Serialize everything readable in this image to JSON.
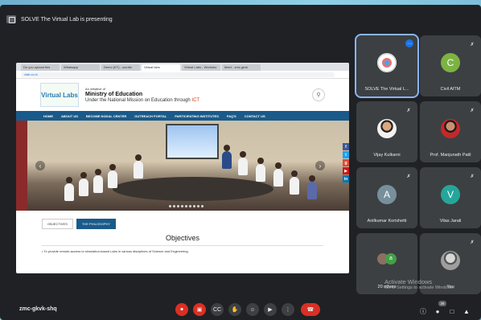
{
  "meeting": {
    "presenting_banner": "SOLVE The Virtual Lab is presenting",
    "meeting_code": "zmc-gkvk-shq"
  },
  "browser": {
    "tabs": [
      "Do you upload this",
      "Whatsapp",
      "Demo (KT) - scrutin",
      "Virtual labs",
      "Virtual Labs - Worksho",
      "Meet - zmc-gkvk"
    ],
    "url": "vlab.co.in"
  },
  "site": {
    "logo_text": "Virtual Labs",
    "initiative": "An initiative of",
    "ministry": "Ministry of Education",
    "mission_prefix": "Under the National Mission on Education through",
    "mission_highlight": "ICT",
    "nav": [
      "HOME",
      "ABOUT US",
      "BECOME NODAL CENTER",
      "OUTREACH PORTAL",
      "PARTICIPATING INSTITUTES",
      "FAQ'S",
      "CONTACT US"
    ],
    "tabs": [
      "OBJECTIVES",
      "THE PHILOSOPHY"
    ],
    "objectives_title": "Objectives",
    "objective_item": "• To provide remote-access to simulation-based Labs in various disciplines of Science and Engineering."
  },
  "participants": [
    {
      "name": "SOLVE The Virtual L...",
      "type": "logo"
    },
    {
      "name": "Civil AITM",
      "initial": "C",
      "color": "#7cb342"
    },
    {
      "name": "Vijay Kulkarni",
      "type": "photo"
    },
    {
      "name": "Prof. Manjunath Patil",
      "type": "photo"
    },
    {
      "name": "Anilkumar Korishetti",
      "initial": "A",
      "color": "#78909c"
    },
    {
      "name": "Vilas Jarali",
      "initial": "V",
      "color": "#26a69a"
    },
    {
      "name": "20 others",
      "type": "group"
    },
    {
      "name": "You",
      "type": "photo"
    }
  ],
  "watermark": {
    "title": "Activate Windows",
    "subtitle": "Go to Settings to activate Windows."
  },
  "controls": {
    "participant_count": "26"
  },
  "icons": {
    "mic_off": "mic-off-icon",
    "cam_off": "camera-off-icon",
    "captions": "captions-icon",
    "hand": "raise-hand-icon",
    "emoji": "emoji-icon",
    "present": "present-icon",
    "more": "more-options-icon",
    "end": "end-call-icon"
  }
}
